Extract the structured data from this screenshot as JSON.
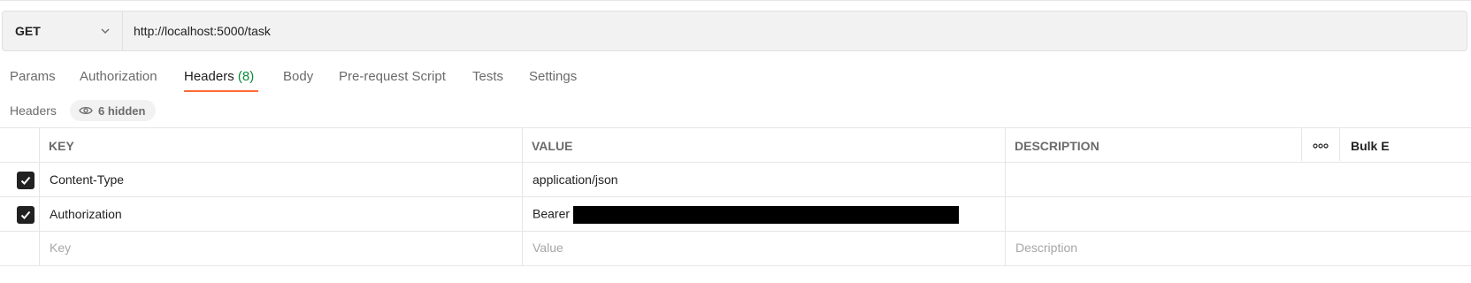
{
  "request": {
    "method": "GET",
    "url": "http://localhost:5000/task"
  },
  "tabs": [
    {
      "label": "Params"
    },
    {
      "label": "Authorization"
    },
    {
      "label": "Headers",
      "count": "(8)",
      "active": true
    },
    {
      "label": "Body"
    },
    {
      "label": "Pre-request Script"
    },
    {
      "label": "Tests"
    },
    {
      "label": "Settings"
    }
  ],
  "headers_section": {
    "label": "Headers",
    "hidden": "6 hidden"
  },
  "table": {
    "columns": {
      "key": "KEY",
      "value": "VALUE",
      "description": "DESCRIPTION"
    },
    "bulk_edit": "Bulk E",
    "rows": [
      {
        "checked": true,
        "key": "Content-Type",
        "value": "application/json",
        "description": ""
      },
      {
        "checked": true,
        "key": "Authorization",
        "value": "Bearer",
        "description": "",
        "value_redacted": true
      }
    ],
    "new_row": {
      "key": "Key",
      "value": "Value",
      "description": "Description"
    }
  },
  "colors": {
    "accent": "#ff6c37",
    "count_green": "#0a8a3c"
  },
  "icons": [
    "chevron-down-icon",
    "eye-icon",
    "checkmark-icon",
    "more-options-icon"
  ]
}
